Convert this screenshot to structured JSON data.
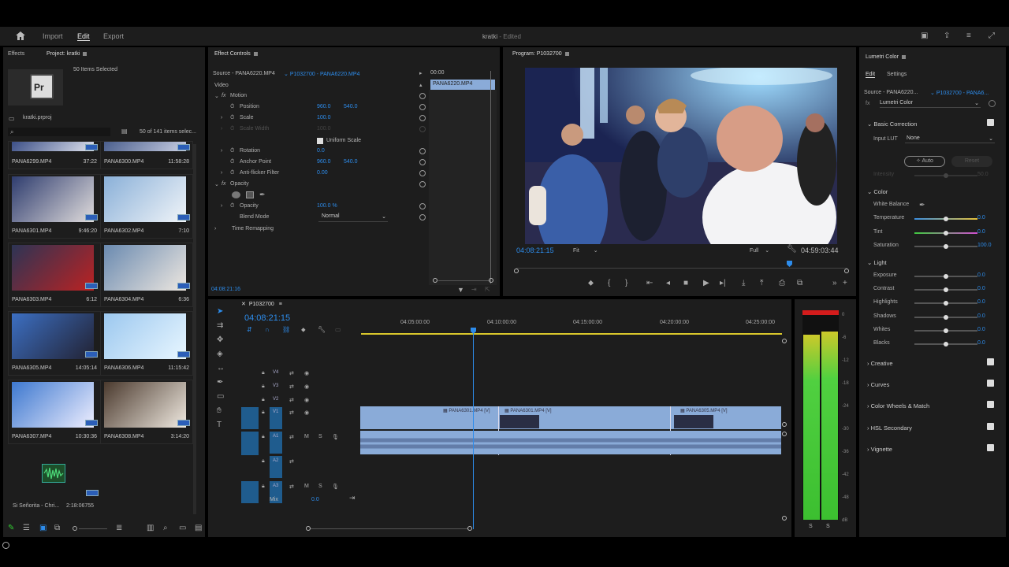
{
  "topbar": {
    "import": "Import",
    "edit": "Edit",
    "export": "Export",
    "title": "kratki",
    "edited": "- Edited"
  },
  "project": {
    "tab_effects": "Effects",
    "tab_project": "Project: kratki",
    "selected": "50 Items Selected",
    "file": "kratki.prproj",
    "count": "50 of 141 items selec...",
    "pr_label": "Pr",
    "items": [
      {
        "name": "PANA6299.MP4",
        "dur": "37:22"
      },
      {
        "name": "PANA6300.MP4",
        "dur": "11:58:28"
      },
      {
        "name": "PANA6301.MP4",
        "dur": "9:46:20"
      },
      {
        "name": "PANA6302.MP4",
        "dur": "7:10"
      },
      {
        "name": "PANA6303.MP4",
        "dur": "6:12"
      },
      {
        "name": "PANA6304.MP4",
        "dur": "6:36"
      },
      {
        "name": "PANA6305.MP4",
        "dur": "14:05:14"
      },
      {
        "name": "PANA6306.MP4",
        "dur": "11:15:42"
      },
      {
        "name": "PANA6307.MP4",
        "dur": "10:30:36"
      },
      {
        "name": "PANA6308.MP4",
        "dur": "3:14:20"
      }
    ],
    "audio": {
      "name": "Si Señorita - Chri...",
      "dur": "2:18:06755"
    }
  },
  "effect_controls": {
    "tab": "Effect Controls",
    "source": "Source - PANA6220.MP4",
    "seq": "P1032700 - PANA6220.MP4",
    "video": "Video",
    "motion": "Motion",
    "position": "Position",
    "pos_x": "960.0",
    "pos_y": "540.0",
    "scale": "Scale",
    "scale_v": "100.0",
    "scale_w": "Scale Width",
    "scale_w_v": "100.0",
    "uniform": "Uniform Scale",
    "rotation": "Rotation",
    "rot_v": "0.0",
    "anchor": "Anchor Point",
    "anc_x": "960.0",
    "anc_y": "540.0",
    "flicker": "Anti-flicker Filter",
    "flicker_v": "0.00",
    "opacity_h": "Opacity",
    "opacity": "Opacity",
    "opacity_v": "100.0 %",
    "blend": "Blend Mode",
    "blend_v": "Normal",
    "remap": "Time Remapping",
    "mini_time": "00:00",
    "mini_clip": "PANA6220.MP4",
    "timecode": "04:08:21:16"
  },
  "program": {
    "tab": "Program: P1032700",
    "timecode": "04:08:21:15",
    "fit": "Fit",
    "full": "Full",
    "duration": "04:59:03:44"
  },
  "timeline": {
    "tab": "P1032700",
    "timecode": "04:08:21:15",
    "ticks": [
      "04:05:00:00",
      "04:10:00:00",
      "04:15:00:00",
      "04:20:00:00",
      "04:25:00:00"
    ],
    "tracks": [
      "V4",
      "V3",
      "V2",
      "V1",
      "A1",
      "A2",
      "A3"
    ],
    "mix": "Mix",
    "mix_v": "0.0",
    "clips": [
      "PANA6301.MP4 [V]",
      "PANA6301.MP4 [V]",
      "PANA6305.MP4 [V]"
    ]
  },
  "meter": {
    "labels": [
      "0",
      "-6",
      "-12",
      "-18",
      "-24",
      "-30",
      "-36",
      "-42",
      "-48",
      "dB"
    ],
    "s1": "S",
    "s2": "S"
  },
  "lumetri": {
    "tab": "Lumetri Color",
    "edit": "Edit",
    "settings": "Settings",
    "source": "Source - PANA6220...",
    "seq": "P1032700 - PANA6...",
    "effect": "Lumetri Color",
    "basic": "Basic Correction",
    "input_lut": "Input LUT",
    "lut_v": "None",
    "auto": "Auto",
    "reset": "Reset",
    "intensity": "Intensity",
    "intensity_v": "50.0",
    "color": "Color",
    "wb": "White Balance",
    "temperature": "Temperature",
    "temp_v": "0.0",
    "tint": "Tint",
    "tint_v": "0.0",
    "saturation": "Saturation",
    "sat_v": "100.0",
    "light": "Light",
    "exposure": "Exposure",
    "exp_v": "0.0",
    "contrast": "Contrast",
    "con_v": "0.0",
    "highlights": "Highlights",
    "hi_v": "0.0",
    "shadows": "Shadows",
    "sh_v": "0.0",
    "whites": "Whites",
    "wh_v": "0.0",
    "blacks": "Blacks",
    "bl_v": "0.0",
    "creative": "Creative",
    "curves": "Curves",
    "wheels": "Color Wheels & Match",
    "hsl": "HSL Secondary",
    "vignette": "Vignette"
  },
  "colors": {
    "accent": "#2d8ceb",
    "clip": "#8aabd8",
    "playhead": "#2d8ceb"
  }
}
